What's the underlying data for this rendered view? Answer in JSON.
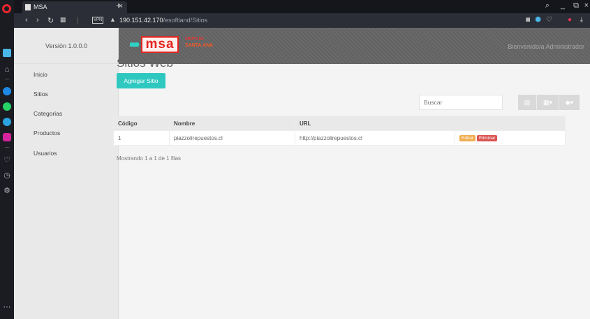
{
  "browser": {
    "tab_title": "MSA",
    "tab_close": "×",
    "new_tab": "+",
    "url_host": "190.151.42.170",
    "url_path": "/esoftland/Sitios",
    "vpn_label": "VPN"
  },
  "app": {
    "version": "Versión 1.0.0.0",
    "welcome": "Bienvenido/a Administrador",
    "logo": {
      "mark": "msa",
      "small_text": "GRUPO DE",
      "big_text": "SANTA ANA",
      "accent_colors": [
        "#2ed3c6",
        "#e32420",
        "#f05a2a"
      ]
    },
    "nav": [
      {
        "label": "Inicio"
      },
      {
        "label": "Sitios"
      },
      {
        "label": "Categorias"
      },
      {
        "label": "Productos"
      },
      {
        "label": "Usuarios"
      }
    ],
    "page_title": "Sitios Web",
    "add_button": "Agregar Sitio",
    "search_placeholder": "Buscar",
    "table": {
      "columns": [
        "Código",
        "Nombre",
        "URL",
        ""
      ],
      "rows": [
        {
          "codigo": "1",
          "nombre": "piazzolirepuestos.cl",
          "url": "http://piazzolirepuestos.cl",
          "edit": "Editar",
          "delete": "Eliminar"
        }
      ]
    },
    "pagination_text": "Mostrando 1 a 1 de 1 filas",
    "colors": {
      "primary": "#2ec8c0",
      "edit": "#f0ad4e",
      "delete": "#d9534f"
    }
  }
}
